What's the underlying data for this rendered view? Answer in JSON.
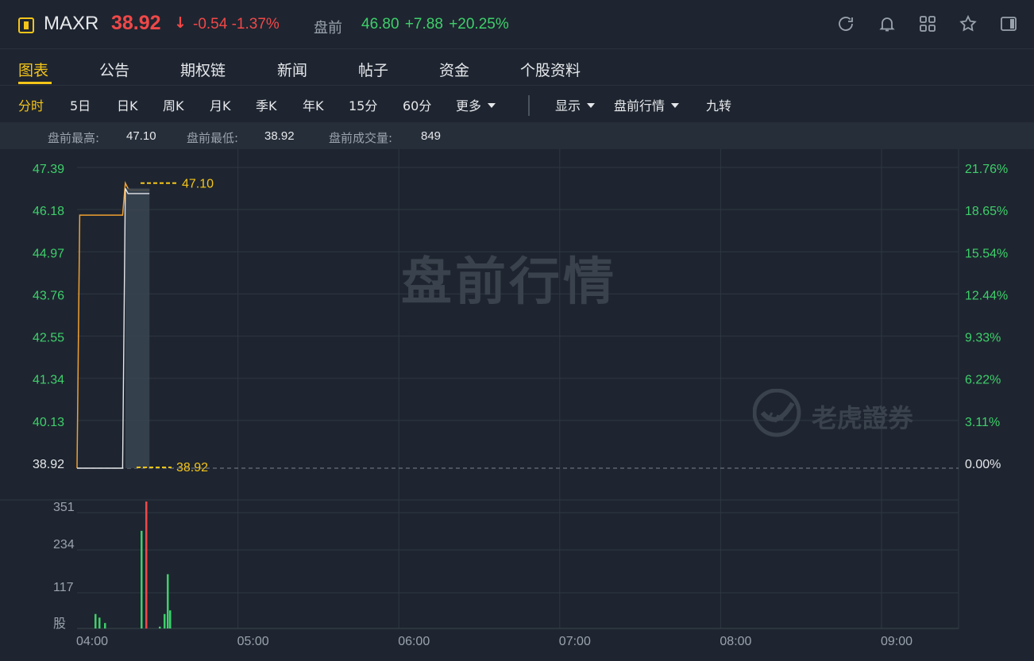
{
  "header": {
    "symbol": "MAXR",
    "price": "38.92",
    "price_arrow": "↓",
    "change": "-0.54",
    "change_pct": "-1.37%",
    "pre_label": "盘前",
    "pre_price": "46.80",
    "pre_change": "+7.88",
    "pre_change_pct": "+20.25%",
    "colors": {
      "down": "#f04848",
      "up": "#3ecf6a",
      "accent": "#f5c518"
    },
    "icons": [
      "refresh-icon",
      "bell-icon",
      "grid-icon",
      "star-icon",
      "panel-icon"
    ]
  },
  "tabs": [
    {
      "label": "图表",
      "active": true
    },
    {
      "label": "公告"
    },
    {
      "label": "期权链"
    },
    {
      "label": "新闻"
    },
    {
      "label": "帖子"
    },
    {
      "label": "资金"
    },
    {
      "label": "个股资料"
    }
  ],
  "periods": [
    {
      "label": "分时",
      "active": true
    },
    {
      "label": "5日"
    },
    {
      "label": "日K"
    },
    {
      "label": "周K"
    },
    {
      "label": "月K"
    },
    {
      "label": "季K"
    },
    {
      "label": "年K"
    },
    {
      "label": "15分"
    },
    {
      "label": "60分"
    },
    {
      "label": "更多"
    }
  ],
  "view_options": [
    {
      "label": "显示"
    },
    {
      "label": "盘前行情"
    },
    {
      "label": "九转"
    }
  ],
  "stats": {
    "high_label": "盘前最高:",
    "high": "47.10",
    "low_label": "盘前最低:",
    "low": "38.92",
    "volume_label": "盘前成交量:",
    "volume": "849"
  },
  "chart": {
    "watermark": "盘前行情",
    "brand": "老虎證券",
    "high_marker": "47.10",
    "low_marker": "38.92",
    "price_ticks": [
      "47.39",
      "46.18",
      "44.97",
      "43.76",
      "42.55",
      "41.34",
      "40.13",
      "38.92"
    ],
    "pct_ticks": [
      "21.76%",
      "18.65%",
      "15.54%",
      "12.44%",
      "9.33%",
      "6.22%",
      "3.11%",
      "0.00%"
    ],
    "volume_ticks": [
      "351",
      "234",
      "117",
      "股"
    ],
    "time_ticks": [
      "04:00",
      "05:00",
      "06:00",
      "07:00",
      "08:00",
      "09:00"
    ]
  },
  "chart_data": {
    "type": "line",
    "x_unit": "time",
    "xlim": [
      "04:00",
      "09:30"
    ],
    "ylim": [
      38.92,
      47.39
    ],
    "series": [
      {
        "name": "",
        "role": "price",
        "x": [
          "04:00",
          "04:01",
          "04:17",
          "04:18",
          "04:19",
          "04:20",
          "04:27"
        ],
        "values": [
          38.92,
          46.18,
          46.18,
          47.1,
          46.95,
          46.9,
          46.9
        ]
      },
      {
        "name": "",
        "role": "average",
        "x": [
          "04:17",
          "04:18",
          "04:19",
          "04:20",
          "04:27"
        ],
        "values": [
          38.92,
          46.95,
          46.8,
          46.8,
          46.8
        ]
      }
    ],
    "volume": {
      "x": [
        "04:00",
        "04:01",
        "04:02",
        "04:16",
        "04:18",
        "04:19",
        "04:26",
        "04:27",
        "04:28"
      ],
      "values": [
        40,
        30,
        15,
        270,
        351,
        5,
        40,
        150,
        50
      ],
      "colors": [
        "up",
        "up",
        "up",
        "up",
        "down",
        "up",
        "up",
        "up",
        "up"
      ]
    }
  }
}
